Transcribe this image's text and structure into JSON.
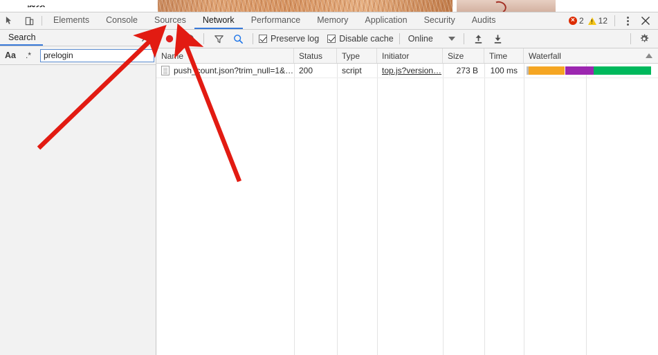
{
  "page_strip": {
    "partial_text": "视频"
  },
  "devtools": {
    "tabs": [
      {
        "label": "Elements",
        "active": false
      },
      {
        "label": "Console",
        "active": false
      },
      {
        "label": "Sources",
        "active": false
      },
      {
        "label": "Network",
        "active": true
      },
      {
        "label": "Performance",
        "active": false
      },
      {
        "label": "Memory",
        "active": false
      },
      {
        "label": "Application",
        "active": false
      },
      {
        "label": "Security",
        "active": false
      },
      {
        "label": "Audits",
        "active": false
      }
    ],
    "icons": {
      "inspect": "inspect-element-icon",
      "device": "toggle-device-toolbar-icon",
      "more": "more-options-icon",
      "close": "close-devtools-icon"
    },
    "status": {
      "error_count": "2",
      "warning_count": "12"
    },
    "accent_color": "#3879d9"
  },
  "search_panel": {
    "tab_label": "Search",
    "close_label": "×",
    "buttons": {
      "match_case": "Aa",
      "regex": ".*"
    },
    "query_value": "prelogin",
    "query_placeholder": "Search",
    "refresh_icon": "refresh-icon",
    "clear_icon": "clear-search-icon"
  },
  "network_toolbar": {
    "record_label": "Record",
    "record_color": "#e02020",
    "clear_label": "Clear",
    "filter_label": "Filter",
    "search_label": "Search",
    "preserve_log": {
      "label": "Preserve log",
      "checked": true
    },
    "disable_cache": {
      "label": "Disable cache",
      "checked": true
    },
    "throttling": {
      "value": "Online"
    },
    "import_label": "Import HAR",
    "export_label": "Export HAR",
    "settings_label": "Settings"
  },
  "requests_table": {
    "columns": [
      "Name",
      "Status",
      "Type",
      "Initiator",
      "Size",
      "Time",
      "Waterfall"
    ],
    "sorted_column": "Waterfall",
    "sort_direction": "asc",
    "rows": [
      {
        "name": "push_count.json?trim_null=1&…",
        "status": "200",
        "type": "script",
        "initiator": "top.js?version…",
        "size": "273 B",
        "time": "100 ms",
        "waterfall": {
          "segments": [
            {
              "name": "stalled",
              "color": "#bdbdbd",
              "start_pct": 0,
              "width_pct": 1.5
            },
            {
              "name": "dns-tcp",
              "color": "#f5a623",
              "start_pct": 1.5,
              "width_pct": 29
            },
            {
              "name": "request-sent",
              "color": "#9c27b0",
              "start_pct": 30.5,
              "width_pct": 23
            },
            {
              "name": "content-download",
              "color": "#00b85c",
              "start_pct": 53.5,
              "width_pct": 45.5
            }
          ]
        }
      }
    ]
  },
  "annotations": [
    {
      "name": "arrow-to-record-button",
      "color": "#e21b12"
    },
    {
      "name": "arrow-to-clear-button",
      "color": "#e21b12"
    }
  ]
}
